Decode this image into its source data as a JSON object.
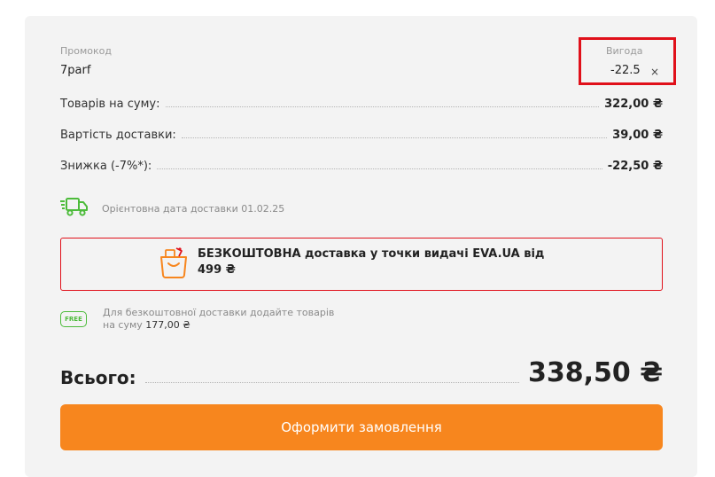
{
  "promo": {
    "label": "Промокод",
    "code": "7parf",
    "benefit_label": "Вигода",
    "benefit_value": "-22.5",
    "remove_symbol": "×"
  },
  "summary": {
    "rows": [
      {
        "label": "Товарів на суму:",
        "value": "322,00 ₴"
      },
      {
        "label": "Вартість доставки:",
        "value": "39,00 ₴"
      },
      {
        "label": "Знижка (-7%*):",
        "value": "-22,50 ₴"
      }
    ]
  },
  "delivery": {
    "icon": "delivery-truck-icon",
    "text": "Орієнтовна дата доставки 01.02.25"
  },
  "free_delivery_banner": {
    "icon": "shopping-bag-icon",
    "text_line1": "БЕЗКОШТОВНА доставка у точки видачі EVA.UA від",
    "text_line2": "499 ₴"
  },
  "free_hint": {
    "badge": "FREE",
    "text_line1": "Для безкоштовної доставки додайте товарів",
    "text_prefix": "на суму",
    "amount": "177,00 ₴"
  },
  "total": {
    "label": "Всього:",
    "value": "338,50 ₴"
  },
  "order_button": {
    "label": "Оформити замовлення"
  },
  "colors": {
    "accent": "#f7861e",
    "highlight": "#e0101a",
    "green": "#4cbb3a",
    "panel_bg": "#f3f3f3"
  }
}
